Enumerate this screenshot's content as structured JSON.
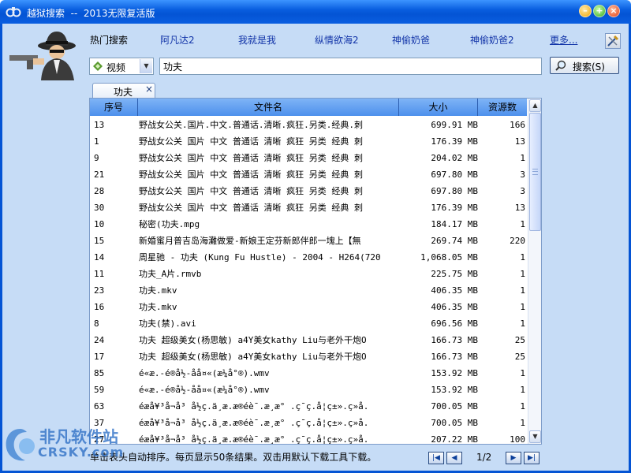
{
  "window": {
    "title": "越狱搜索  --  2013无限复活版",
    "min_label": "–",
    "max_label": "+",
    "close_label": "×"
  },
  "hot": {
    "label": "热门搜索",
    "links": [
      "阿凡达2",
      "我就是我",
      "纵情欲海2",
      "神偷奶爸",
      "神偷奶爸2"
    ],
    "more": "更多..."
  },
  "search": {
    "category": "视频",
    "query": "功夫",
    "button_label": "搜索(S)"
  },
  "tab": {
    "label": "功夫",
    "close": "×"
  },
  "table": {
    "columns": [
      "序号",
      "文件名",
      "大小",
      "资源数"
    ],
    "rows": [
      {
        "no": "13",
        "name": "野战女公关.国片.中文.普通话.清晰.疯狂.另类.经典.刺",
        "size": "699.91 MB",
        "src": "166"
      },
      {
        "no": "1",
        "name": "野战女公关 国片 中文 普通话 清晰 疯狂 另类 经典 刺",
        "size": "176.39 MB",
        "src": "13"
      },
      {
        "no": "9",
        "name": "野战女公关 国片 中文 普通话 清晰 疯狂 另类 经典 刺",
        "size": "204.02 MB",
        "src": "1"
      },
      {
        "no": "21",
        "name": "野战女公关 国片 中文 普通话 清晰 疯狂 另类 经典 刺",
        "size": "697.80 MB",
        "src": "3"
      },
      {
        "no": "28",
        "name": "野战女公关 国片 中文 普通话 清晰 疯狂 另类 经典 刺",
        "size": "697.80 MB",
        "src": "3"
      },
      {
        "no": "30",
        "name": "野战女公关 国片 中文 普通话 清晰 疯狂 另类 经典 刺",
        "size": "176.39 MB",
        "src": "13"
      },
      {
        "no": "10",
        "name": "秘密(功夫.mpg",
        "size": "184.17 MB",
        "src": "1"
      },
      {
        "no": "15",
        "name": "新婚蜜月普吉岛海灘做爱-新娘王定芬新郎伴郎一塊上【無",
        "size": "269.74 MB",
        "src": "220"
      },
      {
        "no": "14",
        "name": "周星驰 - 功夫 (Kung Fu Hustle) - 2004 - H264(720",
        "size": "1,068.05 MB",
        "src": "1"
      },
      {
        "no": "11",
        "name": "功夫_A片.rmvb",
        "size": "225.75 MB",
        "src": "1"
      },
      {
        "no": "23",
        "name": "功夫.mkv",
        "size": "406.35 MB",
        "src": "1"
      },
      {
        "no": "16",
        "name": "功夫.mkv",
        "size": "406.35 MB",
        "src": "1"
      },
      {
        "no": "8",
        "name": "功夫(禁).avi",
        "size": "696.56 MB",
        "src": "1"
      },
      {
        "no": "24",
        "name": "功夫  超级美女(杨思敏) a4Y美女kathy Liu与老外干炮O",
        "size": "166.73 MB",
        "src": "25"
      },
      {
        "no": "17",
        "name": "功夫  超级美女(杨思敏) a4Y美女kathy Liu与老外干炮O",
        "size": "166.73 MB",
        "src": "25"
      },
      {
        "no": "85",
        "name": "é«æ.-é®å½-åå¤«(æ¼å°®).wmv",
        "size": "153.92 MB",
        "src": "1"
      },
      {
        "no": "59",
        "name": "é«æ.-é®å½-åå¤«(æ¼å°®).wmv",
        "size": "153.92 MB",
        "src": "1"
      },
      {
        "no": "63",
        "name": "éæå¥³å¬å³ å½ç.ä¸­æ.æ®éè¯.æ¸æ° .ç¯ç.å¦ç±».ç»å.",
        "size": "700.05 MB",
        "src": "1"
      },
      {
        "no": "37",
        "name": "éæå¥³å¬å³ å½ç.ä¸­æ.æ®éè¯.æ¸æ° .ç¯ç.å¦ç±».ç»å.",
        "size": "700.05 MB",
        "src": "1"
      },
      {
        "no": "27",
        "name": "éæå¥³å¬å³ å½ç.ä¸­æ.æ®éè¯.æ¸æ° .ç¯ç.å¦ç±».ç»å.",
        "size": "207.22 MB",
        "src": "100"
      }
    ]
  },
  "status": {
    "text": "单击表头自动排序。每页显示50条结果。双击用默认下载工具下载。",
    "page": "1/2"
  },
  "watermark": {
    "cn": "非凡软件站",
    "en": "CRSKY.com"
  },
  "colors": {
    "titlebar": "#0a5fe0",
    "client_bg": "#c6dcf6",
    "header": "#4d90ec",
    "link": "#1234a8"
  }
}
